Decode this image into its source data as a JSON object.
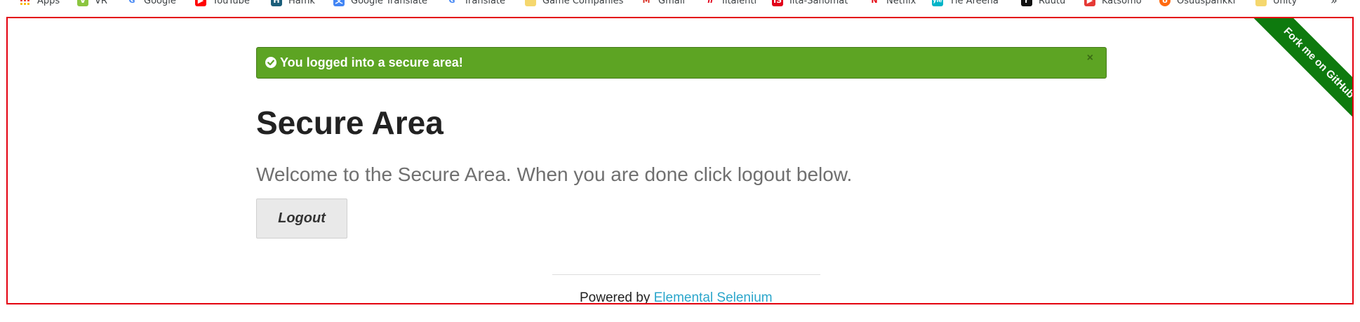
{
  "bookmarks": [
    {
      "label": "Apps",
      "icon": "apps-grid-icon",
      "color": "#4285f4"
    },
    {
      "label": "VR",
      "icon": "vr-icon",
      "color": "#8bc53f"
    },
    {
      "label": "Google",
      "icon": "google-icon",
      "color": "#4285f4"
    },
    {
      "label": "YouTube",
      "icon": "youtube-icon",
      "color": "#ff0000"
    },
    {
      "label": "Hamk",
      "icon": "hamk-icon",
      "color": "#1b5e7a"
    },
    {
      "label": "Google Translate",
      "icon": "translate-icon",
      "color": "#4285f4"
    },
    {
      "label": "Translate",
      "icon": "google-icon",
      "color": "#4285f4"
    },
    {
      "label": "Game Companies",
      "icon": "folder-icon",
      "color": "#f5d76e"
    },
    {
      "label": "Gmail",
      "icon": "gmail-icon",
      "color": "#d93025"
    },
    {
      "label": "Iltalehti",
      "icon": "iltalehti-icon",
      "color": "#e2001a"
    },
    {
      "label": "Ilta-Sanomat",
      "icon": "iltasanomat-icon",
      "color": "#e2001a"
    },
    {
      "label": "Netflix",
      "icon": "netflix-icon",
      "color": "#e50914"
    },
    {
      "label": "Yle Areena",
      "icon": "yle-icon",
      "color": "#00b4c8"
    },
    {
      "label": "Ruutu",
      "icon": "ruutu-icon",
      "color": "#111111"
    },
    {
      "label": "Katsomo",
      "icon": "katsomo-icon",
      "color": "#e53935"
    },
    {
      "label": "Osuuspankki",
      "icon": "op-icon",
      "color": "#ff6a10"
    },
    {
      "label": "Unity",
      "icon": "folder-icon",
      "color": "#f5d76e"
    }
  ],
  "bookmarks_overflow": "»",
  "flash": {
    "message": "You logged into a secure area!",
    "close": "×",
    "color": "#5da423"
  },
  "page": {
    "title": "Secure Area",
    "subheader": "Welcome to the Secure Area. When you are done click logout below.",
    "logout_label": "Logout"
  },
  "footer": {
    "powered_by": "Powered by",
    "link_text": "Elemental Selenium"
  },
  "ribbon": {
    "label": "Fork me on GitHub",
    "color": "#0e7a0e"
  }
}
